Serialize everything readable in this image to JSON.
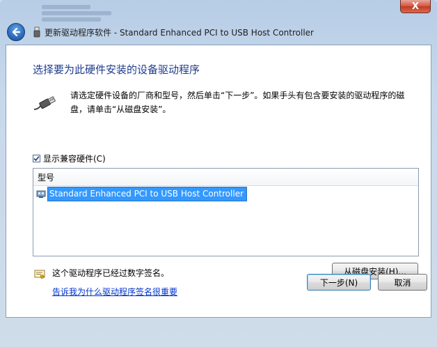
{
  "window": {
    "title": "更新驱动程序软件 - Standard Enhanced PCI to USB Host Controller",
    "close_label": "X"
  },
  "page": {
    "heading": "选择要为此硬件安装的设备驱动程序",
    "description": "请选定硬件设备的厂商和型号，然后单击“下一步”。如果手头有包含要安装的驱动程序的磁盘，请单击“从磁盘安装”。"
  },
  "compat": {
    "checked": true,
    "label": "显示兼容硬件(C)"
  },
  "models": {
    "header": "型号",
    "items": [
      "Standard Enhanced PCI to USB Host Controller"
    ]
  },
  "signature": {
    "text": "这个驱动程序已经过数字签名。",
    "link": "告诉我为什么驱动程序签名很重要"
  },
  "buttons": {
    "have_disk": "从磁盘安装(H)...",
    "next": "下一步(N)",
    "cancel": "取消"
  },
  "colors": {
    "heading": "#1e3c8c",
    "selection": "#3399ff",
    "link": "#0033cc"
  }
}
